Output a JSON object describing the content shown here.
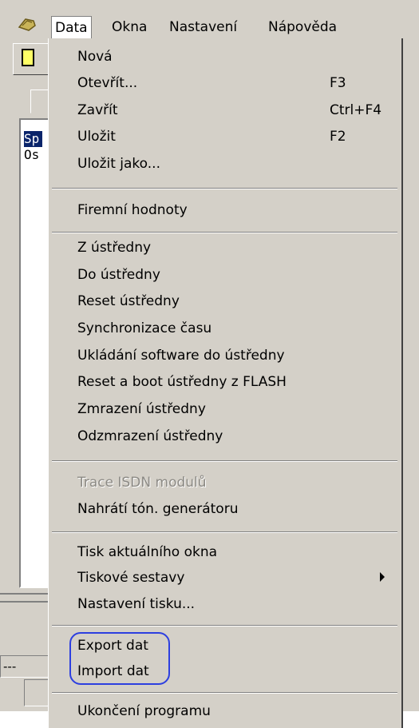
{
  "menubar": {
    "items": [
      "Data",
      "Okna",
      "Nastavení",
      "Nápověda"
    ]
  },
  "left_panel": {
    "items": [
      "Sp",
      "Os"
    ]
  },
  "status": {
    "field1": "---"
  },
  "data_menu": {
    "items": [
      {
        "label": "Nová",
        "shortcut": ""
      },
      {
        "label": "Otevřít...",
        "shortcut": "F3"
      },
      {
        "label": "Zavřít",
        "shortcut": "Ctrl+F4"
      },
      {
        "label": "Uložit",
        "shortcut": "F2"
      },
      {
        "label": "Uložit jako...",
        "shortcut": ""
      },
      {
        "label": "Firemní hodnoty"
      },
      {
        "label": "Z ústředny"
      },
      {
        "label": "Do ústředny"
      },
      {
        "label": "Reset ústředny"
      },
      {
        "label": "Synchronizace času"
      },
      {
        "label": "Ukládání software do ústředny"
      },
      {
        "label": "Reset a boot ústředny z FLASH"
      },
      {
        "label": "Zmrazení ústředny"
      },
      {
        "label": "Odzmrazení ústředny"
      },
      {
        "label": "Trace ISDN modulů",
        "disabled": true
      },
      {
        "label": "Nahrátí tón. generátoru"
      },
      {
        "label": "Tisk aktuálního okna"
      },
      {
        "label": "Tiskové sestavy",
        "submenu": true
      },
      {
        "label": "Nastavení tisku..."
      },
      {
        "label": "Export dat"
      },
      {
        "label": "Import dat"
      },
      {
        "label": "Ukončení programu"
      }
    ]
  },
  "colors": {
    "face": "#d4d0c8",
    "selection": "#0a246a",
    "annotation": "#2d3fe0"
  }
}
